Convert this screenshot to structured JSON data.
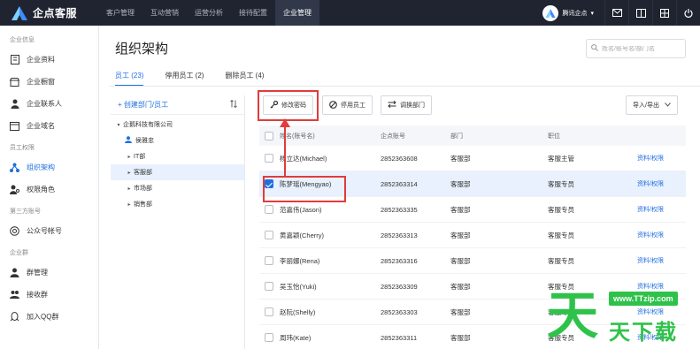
{
  "app": {
    "name": "企点客服"
  },
  "topnav": {
    "items": [
      "客户管理",
      "互动营销",
      "运营分析",
      "接待配置",
      "企业管理"
    ],
    "active_index": 4,
    "company": "腾讯企点"
  },
  "sidebar": {
    "groups": [
      {
        "title": "企业信息",
        "items": [
          {
            "label": "企业资料",
            "icon": "building-icon"
          },
          {
            "label": "企业橱窗",
            "icon": "store-icon"
          },
          {
            "label": "企业联系人",
            "icon": "contact-icon"
          },
          {
            "label": "企业域名",
            "icon": "domain-icon"
          }
        ]
      },
      {
        "title": "员工权限",
        "items": [
          {
            "label": "组织架构",
            "icon": "org-chart-icon",
            "active": true
          },
          {
            "label": "权限角色",
            "icon": "role-icon"
          }
        ]
      },
      {
        "title": "第三方账号",
        "items": [
          {
            "label": "公众号帐号",
            "icon": "official-account-icon"
          }
        ]
      },
      {
        "title": "企业群",
        "items": [
          {
            "label": "群管理",
            "icon": "group-icon"
          },
          {
            "label": "接收群",
            "icon": "receive-group-icon"
          },
          {
            "label": "加入QQ群",
            "icon": "qq-group-icon"
          }
        ]
      }
    ]
  },
  "main": {
    "title": "组织架构",
    "search_placeholder": "姓名/账号名/部门名",
    "tabs": [
      "员工 (23)",
      "停用员工 (2)",
      "删除员工 (4)"
    ],
    "active_tab": 0
  },
  "tree": {
    "create_label": "+ 创建部门/员工",
    "company": "企鹅科技有限公司",
    "user": "侯雅忠",
    "depts": [
      "IT部",
      "客服部",
      "市场部",
      "销售部"
    ],
    "selected_dept": 1
  },
  "toolbar": {
    "change_password": "修改密码",
    "disable_staff": "停用员工",
    "move_dept": "调换部门",
    "import_export": "导入/导出"
  },
  "table": {
    "headers": [
      "姓名(账号名)",
      "企点账号",
      "部门",
      "职位",
      ""
    ],
    "rows": [
      {
        "name": "杨立达(Michael)",
        "account": "2852363608",
        "dept": "客服部",
        "title": "客服主管",
        "op": "资料/权限",
        "checked": false
      },
      {
        "name": "陈梦瑶(Mengyao)",
        "account": "2852363314",
        "dept": "客服部",
        "title": "客服专员",
        "op": "资料/权限",
        "checked": true
      },
      {
        "name": "范嘉伟(Jason)",
        "account": "2852363335",
        "dept": "客服部",
        "title": "客服专员",
        "op": "资料/权限",
        "checked": false
      },
      {
        "name": "黄嘉颖(Cherry)",
        "account": "2852363313",
        "dept": "客服部",
        "title": "客服专员",
        "op": "资料/权限",
        "checked": false
      },
      {
        "name": "李丽娜(Rena)",
        "account": "2852363316",
        "dept": "客服部",
        "title": "客服专员",
        "op": "资料/权限",
        "checked": false
      },
      {
        "name": "吴玉怡(Yuki)",
        "account": "2852363309",
        "dept": "客服部",
        "title": "客服专员",
        "op": "资料/权限",
        "checked": false
      },
      {
        "name": "赵阮(Shelly)",
        "account": "2852363303",
        "dept": "客服部",
        "title": "客服专员",
        "op": "资料/权限",
        "checked": false
      },
      {
        "name": "周玮(Kate)",
        "account": "2852363311",
        "dept": "客服部",
        "title": "客服专员",
        "op": "资料/权限",
        "checked": false
      }
    ]
  },
  "watermark": {
    "big": "天",
    "url": "www.TTzip.com",
    "text": "天下载"
  },
  "colors": {
    "accent": "#1f6fe0",
    "topbar": "#1f2430",
    "annotation": "#e23b3b",
    "watermark": "#2fc24a"
  }
}
